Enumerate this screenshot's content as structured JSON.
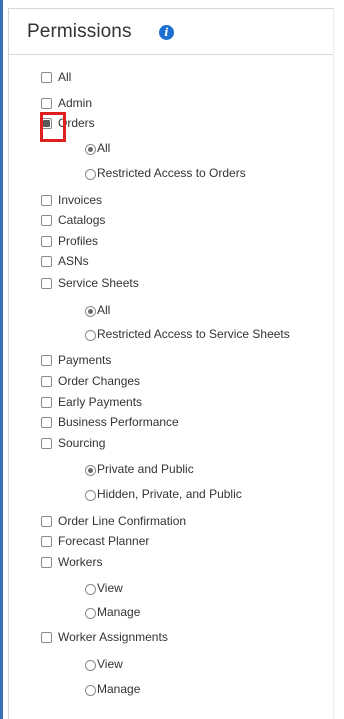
{
  "header": {
    "title": "Permissions",
    "info_icon": "info-icon"
  },
  "permissions": [
    {
      "label": "All",
      "checked": false
    },
    {
      "label": "Admin",
      "checked": false
    },
    {
      "label": "Orders",
      "checked": true,
      "highlighted": true,
      "options": [
        {
          "label": "All",
          "selected": true
        },
        {
          "label": "Restricted Access to Orders",
          "selected": false
        }
      ]
    },
    {
      "label": "Invoices",
      "checked": false
    },
    {
      "label": "Catalogs",
      "checked": false
    },
    {
      "label": "Profiles",
      "checked": false
    },
    {
      "label": "ASNs",
      "checked": false
    },
    {
      "label": "Service Sheets",
      "checked": false,
      "options": [
        {
          "label": "All",
          "selected": true
        },
        {
          "label": "Restricted Access to Service Sheets",
          "selected": false
        }
      ]
    },
    {
      "label": "Payments",
      "checked": false
    },
    {
      "label": "Order Changes",
      "checked": false
    },
    {
      "label": "Early Payments",
      "checked": false
    },
    {
      "label": "Business Performance",
      "checked": false
    },
    {
      "label": "Sourcing",
      "checked": false,
      "options": [
        {
          "label": "Private and Public",
          "selected": true
        },
        {
          "label": "Hidden, Private, and Public",
          "selected": false
        }
      ]
    },
    {
      "label": "Order Line Confirmation",
      "checked": false
    },
    {
      "label": "Forecast Planner",
      "checked": false
    },
    {
      "label": "Workers",
      "checked": false,
      "options": [
        {
          "label": "View",
          "selected": false
        },
        {
          "label": "Manage",
          "selected": false
        }
      ]
    },
    {
      "label": "Worker Assignments",
      "checked": false,
      "options": [
        {
          "label": "View",
          "selected": false
        },
        {
          "label": "Manage",
          "selected": false
        }
      ]
    }
  ],
  "colors": {
    "highlight": "#e02020",
    "info_icon": "#1d6fd0",
    "left_rule": "#3b6fb6"
  }
}
